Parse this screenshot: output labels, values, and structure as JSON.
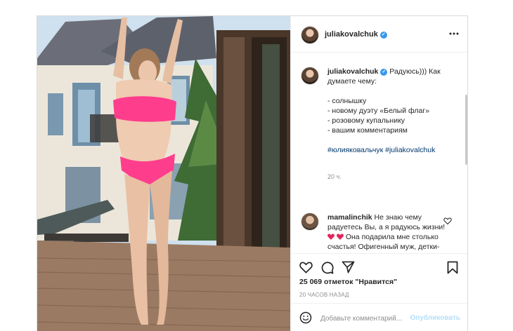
{
  "post": {
    "username": "juliakovalchuk",
    "more_icon": "more-horizontal-icon",
    "caption": {
      "text_first": "Радуюсь))) Как думаете чему:",
      "list": [
        "- солнышку",
        "- новому дуэту «Белый флаг»",
        "- розовому купальнику",
        "- вашим комментариям"
      ],
      "hashtags": "#юлияковальчук #juliakovalchuk",
      "time": "20 ч."
    },
    "comment": {
      "username": "mamalinchik",
      "text_before_hearts": "Не знаю чему радуетесь Вы, а я радуюсь жизни!",
      "text_after_hearts": "Она подарила мне столько счастья! Офигенный муж, детки-двойняшки и кот, который их нянчит!"
    },
    "likes": "25 069 отметок \"Нравится\"",
    "time_ago": "20 ЧАСОВ НАЗАД",
    "add_comment_placeholder": "Добавьте комментарий...",
    "publish_label": "Опубликовать"
  },
  "colors": {
    "swimsuit": "#ff3d8d",
    "verified": "#3897f0",
    "hashtag": "#00376b",
    "publish_disabled": "#b2dffc"
  }
}
